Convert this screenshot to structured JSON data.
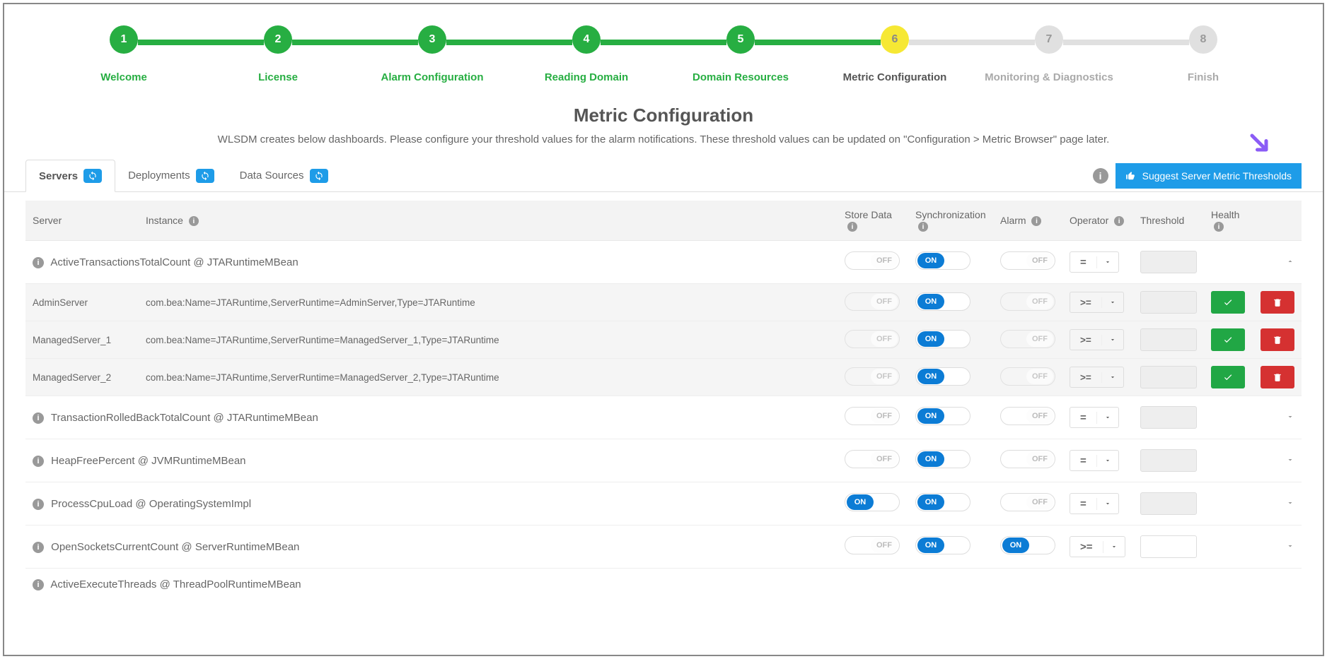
{
  "stepper": {
    "steps": [
      {
        "num": "1",
        "label": "Welcome",
        "state": "done"
      },
      {
        "num": "2",
        "label": "License",
        "state": "done"
      },
      {
        "num": "3",
        "label": "Alarm Configuration",
        "state": "done"
      },
      {
        "num": "4",
        "label": "Reading Domain",
        "state": "done"
      },
      {
        "num": "5",
        "label": "Domain Resources",
        "state": "done"
      },
      {
        "num": "6",
        "label": "Metric Configuration",
        "state": "current"
      },
      {
        "num": "7",
        "label": "Monitoring & Diagnostics",
        "state": "future"
      },
      {
        "num": "8",
        "label": "Finish",
        "state": "future"
      }
    ]
  },
  "page_title": "Metric Configuration",
  "page_desc": "WLSDM creates below dashboards. Please configure your threshold values for the alarm notifications. These threshold values can be updated on \"Configuration > Metric Browser\" page later.",
  "tabs": {
    "servers": "Servers",
    "deployments": "Deployments",
    "datasources": "Data Sources"
  },
  "suggest_btn": "Suggest Server Metric Thresholds",
  "columns": {
    "server": "Server",
    "instance": "Instance",
    "storedata": "Store Data",
    "sync": "Synchronization",
    "alarm": "Alarm",
    "operator": "Operator",
    "threshold": "Threshold",
    "health": "Health"
  },
  "toggle_on": "ON",
  "toggle_off": "OFF",
  "metrics": [
    {
      "name": "ActiveTransactionsTotalCount @ JTARuntimeMBean",
      "store": "OFF",
      "sync": "ON",
      "alarm": "OFF",
      "op": "=",
      "expanded": true,
      "children": [
        {
          "server": "AdminServer",
          "instance": "com.bea:Name=JTARuntime,ServerRuntime=AdminServer,Type=JTARuntime",
          "store": "OFF",
          "sync": "ON",
          "alarm": "OFF",
          "op": ">="
        },
        {
          "server": "ManagedServer_1",
          "instance": "com.bea:Name=JTARuntime,ServerRuntime=ManagedServer_1,Type=JTARuntime",
          "store": "OFF",
          "sync": "ON",
          "alarm": "OFF",
          "op": ">="
        },
        {
          "server": "ManagedServer_2",
          "instance": "com.bea:Name=JTARuntime,ServerRuntime=ManagedServer_2,Type=JTARuntime",
          "store": "OFF",
          "sync": "ON",
          "alarm": "OFF",
          "op": ">="
        }
      ]
    },
    {
      "name": "TransactionRolledBackTotalCount @ JTARuntimeMBean",
      "store": "OFF",
      "sync": "ON",
      "alarm": "OFF",
      "op": "=",
      "expanded": false
    },
    {
      "name": "HeapFreePercent @ JVMRuntimeMBean",
      "store": "OFF",
      "sync": "ON",
      "alarm": "OFF",
      "op": "=",
      "expanded": false
    },
    {
      "name": "ProcessCpuLoad @ OperatingSystemImpl",
      "store": "ON",
      "sync": "ON",
      "alarm": "OFF",
      "op": "=",
      "expanded": false
    },
    {
      "name": "OpenSocketsCurrentCount @ ServerRuntimeMBean",
      "store": "OFF",
      "sync": "ON",
      "alarm": "ON",
      "op": ">=",
      "th_enabled": true,
      "expanded": false
    },
    {
      "name": "ActiveExecuteThreads @ ThreadPoolRuntimeMBean",
      "store": "",
      "sync": "",
      "alarm": "",
      "op": "",
      "expanded": false,
      "partial": true
    }
  ]
}
